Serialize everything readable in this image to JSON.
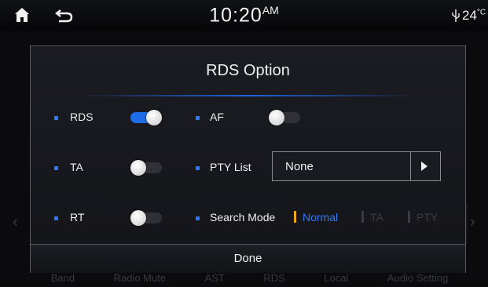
{
  "status": {
    "time": "10:20",
    "ampm": "AM",
    "temperature": "24",
    "temp_unit": "°C"
  },
  "background": {
    "menu": [
      "Band",
      "Radio Mute",
      "AST",
      "RDS",
      "Local",
      "Audio Setting"
    ]
  },
  "dialog": {
    "title": "RDS Option",
    "options": {
      "rds": {
        "label": "RDS",
        "on": true
      },
      "af": {
        "label": "AF",
        "on": false
      },
      "ta": {
        "label": "TA",
        "on": false
      },
      "pty_list": {
        "label": "PTY List",
        "value": "None"
      },
      "rt": {
        "label": "RT",
        "on": false
      },
      "search_mode": {
        "label": "Search Mode",
        "choices": [
          "Normal",
          "TA",
          "PTY"
        ],
        "selected": "Normal"
      }
    },
    "done_label": "Done"
  },
  "colors": {
    "accent": "#1e6ce6",
    "segment_marker": "#f2a51a"
  }
}
